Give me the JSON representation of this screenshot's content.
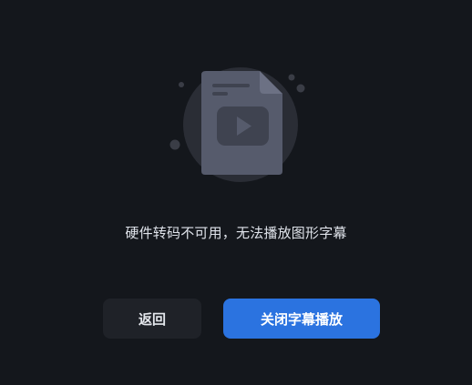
{
  "dialog": {
    "message": "硬件转码不可用，无法播放图形字幕",
    "back_label": "返回",
    "close_subtitle_label": "关闭字幕播放"
  },
  "illustration": {
    "icon": "subtitle-file-video-icon"
  },
  "colors": {
    "background": "#14171c",
    "secondary_button": "#1f2228",
    "primary_button": "#2b73e0",
    "icon_fill": "#565b6c",
    "icon_halo": "#2a2d35"
  }
}
